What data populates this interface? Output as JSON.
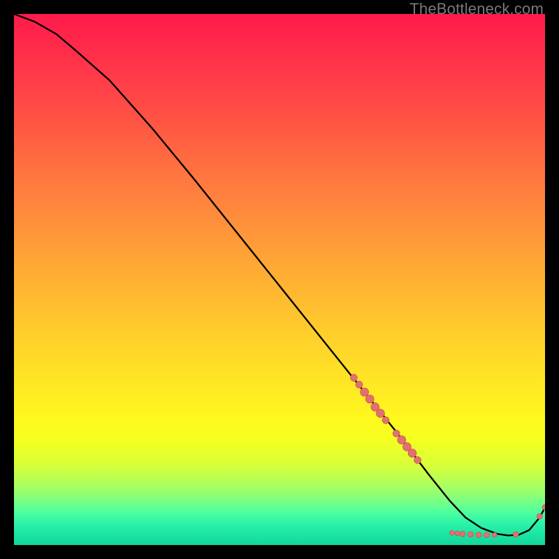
{
  "watermark": "TheBottleneck.com",
  "colors": {
    "curve": "#000000",
    "dot_fill": "#e37070",
    "dot_stroke": "#bb4d4d"
  },
  "chart_data": {
    "type": "line",
    "title": "",
    "xlabel": "",
    "ylabel": "",
    "xlim": [
      0,
      100
    ],
    "ylim": [
      0,
      100
    ],
    "series": [
      {
        "name": "curve",
        "x": [
          0,
          4,
          8,
          12,
          18,
          26,
          34,
          42,
          50,
          58,
          66,
          72,
          78,
          82,
          85,
          88,
          91,
          93,
          95,
          97,
          99,
          100
        ],
        "y": [
          100,
          98.5,
          96.2,
          92.8,
          87.5,
          78.5,
          68.8,
          58.8,
          48.8,
          38.8,
          28.8,
          21.3,
          13.4,
          8.4,
          5.2,
          3.2,
          2.1,
          1.8,
          1.9,
          2.8,
          5.2,
          7.1
        ]
      }
    ],
    "dots_on_curve": [
      {
        "x": 64,
        "y": 31.5,
        "r": 5
      },
      {
        "x": 65,
        "y": 30.2,
        "r": 5
      },
      {
        "x": 66,
        "y": 28.8,
        "r": 6
      },
      {
        "x": 67,
        "y": 27.5,
        "r": 6
      },
      {
        "x": 68,
        "y": 26.0,
        "r": 6
      },
      {
        "x": 69,
        "y": 24.8,
        "r": 6
      },
      {
        "x": 70,
        "y": 23.5,
        "r": 5
      },
      {
        "x": 72,
        "y": 21.0,
        "r": 5
      },
      {
        "x": 73,
        "y": 19.8,
        "r": 6
      },
      {
        "x": 74,
        "y": 18.5,
        "r": 6
      },
      {
        "x": 75,
        "y": 17.3,
        "r": 6
      },
      {
        "x": 76,
        "y": 16.0,
        "r": 5
      },
      {
        "x": 82.5,
        "y": 2.3,
        "r": 3.5
      },
      {
        "x": 83.5,
        "y": 2.2,
        "r": 3.5
      },
      {
        "x": 84.5,
        "y": 2.1,
        "r": 4
      },
      {
        "x": 86,
        "y": 2.0,
        "r": 4
      },
      {
        "x": 87.5,
        "y": 1.9,
        "r": 4
      },
      {
        "x": 89,
        "y": 1.9,
        "r": 4
      },
      {
        "x": 90.5,
        "y": 1.9,
        "r": 3.5
      },
      {
        "x": 94.5,
        "y": 2.0,
        "r": 4
      },
      {
        "x": 99,
        "y": 5.4,
        "r": 4
      },
      {
        "x": 100,
        "y": 7.1,
        "r": 4
      }
    ]
  }
}
